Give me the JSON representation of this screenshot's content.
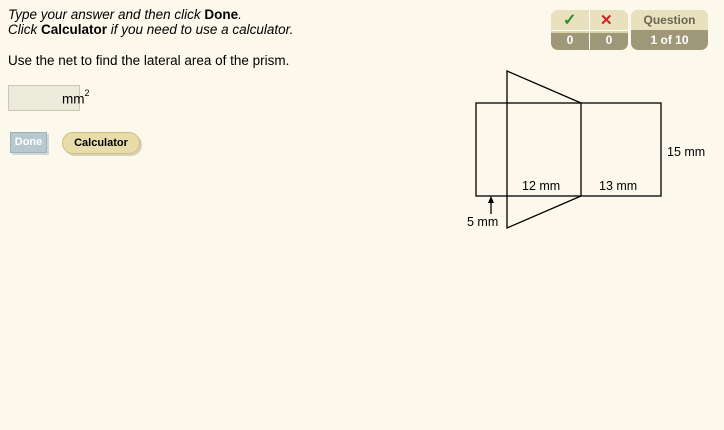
{
  "instructions": {
    "line1_prefix": "Type your answer and then click ",
    "line1_bold": "Done",
    "line1_suffix": ".",
    "line2_prefix": "Click ",
    "line2_bold": "Calculator",
    "line2_suffix": " if you need to use a calculator."
  },
  "question_text": "Use the net to find the lateral area of the prism.",
  "answer": {
    "value": "",
    "unit": "mm",
    "unit_exponent": "2"
  },
  "buttons": {
    "done": "Done",
    "calculator": "Calculator"
  },
  "score": {
    "correct": "0",
    "incorrect": "0",
    "question_label": "Question",
    "question_progress": "1 of 10"
  },
  "figure": {
    "label_height": "15 mm",
    "label_side_a": "12 mm",
    "label_side_b": "13 mm",
    "label_side_c": "5 mm"
  }
}
